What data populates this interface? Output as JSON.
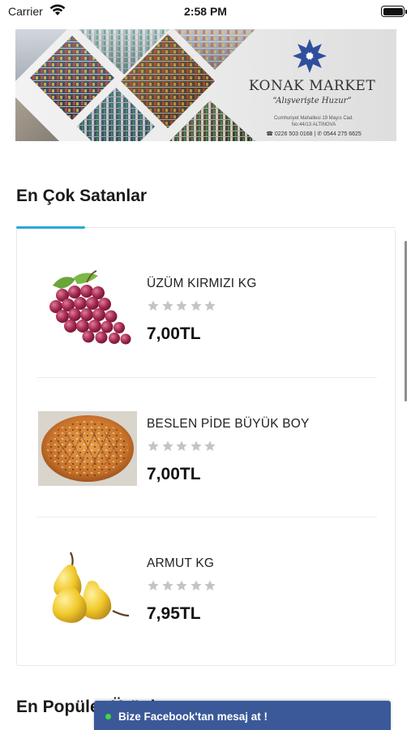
{
  "status_bar": {
    "carrier": "Carrier",
    "time": "2:58 PM"
  },
  "banner": {
    "store_name": "KONAK MARKET",
    "slogan": "“Alışverişte Huzur”",
    "address_line1": "Cumhuriyet Mahallesi 19 Mayıs Cad.",
    "address_line2": "No:44/13 ALTINOVA",
    "phones": "☎ 0226 503 0168 | ✆ 0544 275 6625"
  },
  "sections": {
    "best_sellers_title": "En Çok Satanlar",
    "popular_title": "En Popüler Ürünler"
  },
  "products": [
    {
      "name": "ÜZÜM KIRMIZI KG",
      "price": "7,00TL",
      "rating": 0,
      "image": "red-grapes"
    },
    {
      "name": "BESLEN PİDE BÜYÜK BOY",
      "price": "7,00TL",
      "rating": 0,
      "image": "pide-bread"
    },
    {
      "name": "ARMUT KG",
      "price": "7,95TL",
      "rating": 0,
      "image": "pears"
    }
  ],
  "facebook_chat": {
    "label": "Bize Facebook'tan mesaj at !"
  },
  "colors": {
    "accent": "#2ba7d9",
    "facebook": "#3b5998",
    "online": "#42d942",
    "star_empty": "#c4c4c4"
  }
}
